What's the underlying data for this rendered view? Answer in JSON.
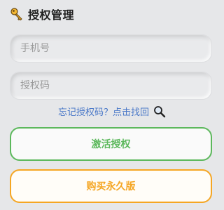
{
  "header": {
    "title": "授权管理",
    "icon": "key-icon"
  },
  "form": {
    "phone_placeholder": "手机号",
    "phone_value": "",
    "code_placeholder": "授权码",
    "code_value": ""
  },
  "forgot": {
    "label": "忘记授权码？点击找回",
    "icon": "search-icon"
  },
  "buttons": {
    "activate_label": "激活授权",
    "buy_label": "购买永久版"
  },
  "colors": {
    "activate": "#5cb85c",
    "buy": "#f5a623",
    "link": "#4a78c8",
    "background": "#e6e7e9"
  }
}
